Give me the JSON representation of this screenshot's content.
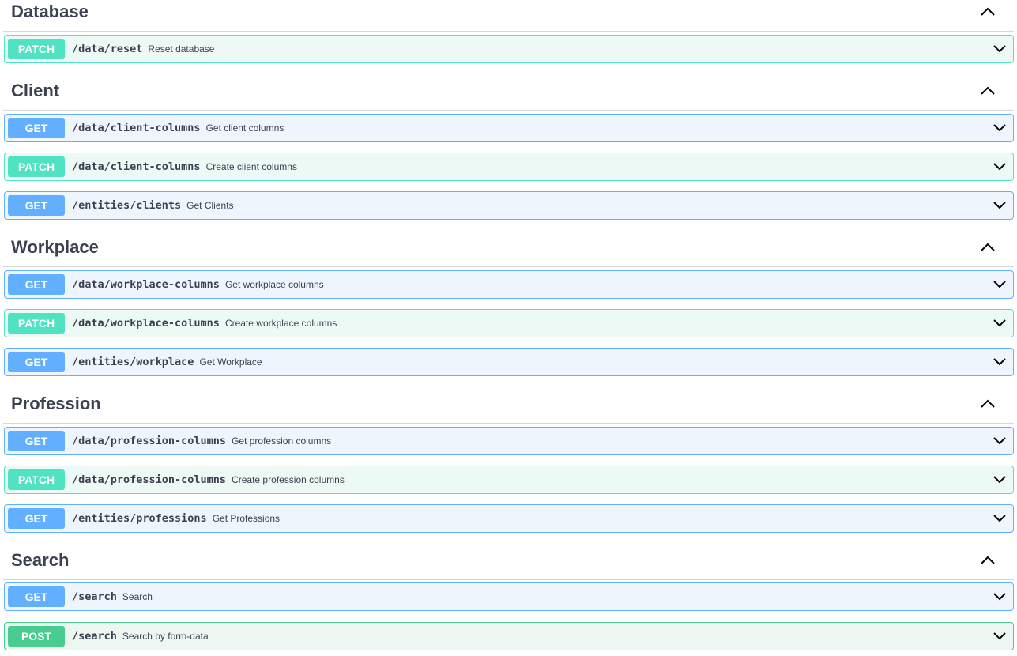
{
  "sections": [
    {
      "title": "Database",
      "operations": [
        {
          "method": "PATCH",
          "path": "/data/reset",
          "summary": "Reset database"
        }
      ]
    },
    {
      "title": "Client",
      "operations": [
        {
          "method": "GET",
          "path": "/data/client-columns",
          "summary": "Get client columns"
        },
        {
          "method": "PATCH",
          "path": "/data/client-columns",
          "summary": "Create client columns"
        },
        {
          "method": "GET",
          "path": "/entities/clients",
          "summary": "Get Clients"
        }
      ]
    },
    {
      "title": "Workplace",
      "operations": [
        {
          "method": "GET",
          "path": "/data/workplace-columns",
          "summary": "Get workplace columns"
        },
        {
          "method": "PATCH",
          "path": "/data/workplace-columns",
          "summary": "Create workplace columns"
        },
        {
          "method": "GET",
          "path": "/entities/workplace",
          "summary": "Get Workplace"
        }
      ]
    },
    {
      "title": "Profession",
      "operations": [
        {
          "method": "GET",
          "path": "/data/profession-columns",
          "summary": "Get profession columns"
        },
        {
          "method": "PATCH",
          "path": "/data/profession-columns",
          "summary": "Create profession columns"
        },
        {
          "method": "GET",
          "path": "/entities/professions",
          "summary": "Get Professions"
        }
      ]
    },
    {
      "title": "Search",
      "operations": [
        {
          "method": "GET",
          "path": "/search",
          "summary": "Search"
        },
        {
          "method": "POST",
          "path": "/search",
          "summary": "Search by form-data"
        }
      ]
    }
  ],
  "colors": {
    "get": "#61affe",
    "patch": "#50e3c2",
    "post": "#49cc90",
    "text": "#3b4151"
  },
  "icons": {
    "section_toggle": "chevron-up-icon",
    "operation_toggle": "chevron-down-icon"
  }
}
